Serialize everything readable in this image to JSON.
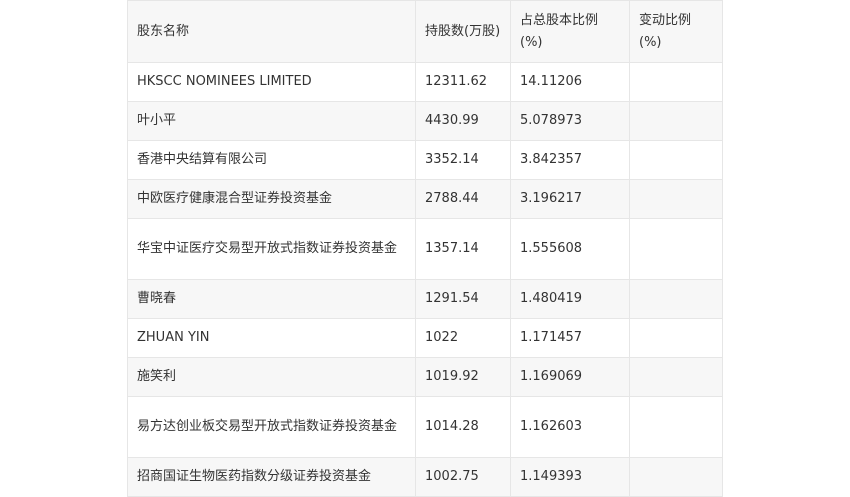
{
  "headers": [
    "股东名称",
    "持股数(万股)",
    "占总股本比例(%)",
    "变动比例(%)"
  ],
  "rows": [
    {
      "name": "HKSCC NOMINEES LIMITED",
      "shares": "12311.62",
      "ratio": "14.11206",
      "change": ""
    },
    {
      "name": "叶小平",
      "shares": "4430.99",
      "ratio": "5.078973",
      "change": ""
    },
    {
      "name": "香港中央结算有限公司",
      "shares": "3352.14",
      "ratio": "3.842357",
      "change": ""
    },
    {
      "name": "中欧医疗健康混合型证券投资基金",
      "shares": "2788.44",
      "ratio": "3.196217",
      "change": ""
    },
    {
      "name": "华宝中证医疗交易型开放式指数证券投资基金",
      "shares": "1357.14",
      "ratio": "1.555608",
      "change": ""
    },
    {
      "name": "曹晓春",
      "shares": "1291.54",
      "ratio": "1.480419",
      "change": ""
    },
    {
      "name": "ZHUAN YIN",
      "shares": "1022",
      "ratio": "1.171457",
      "change": ""
    },
    {
      "name": "施笑利",
      "shares": "1019.92",
      "ratio": "1.169069",
      "change": ""
    },
    {
      "name": "易方达创业板交易型开放式指数证券投资基金",
      "shares": "1014.28",
      "ratio": "1.162603",
      "change": ""
    },
    {
      "name": "招商国证生物医药指数分级证券投资基金",
      "shares": "1002.75",
      "ratio": "1.149393",
      "change": ""
    }
  ]
}
